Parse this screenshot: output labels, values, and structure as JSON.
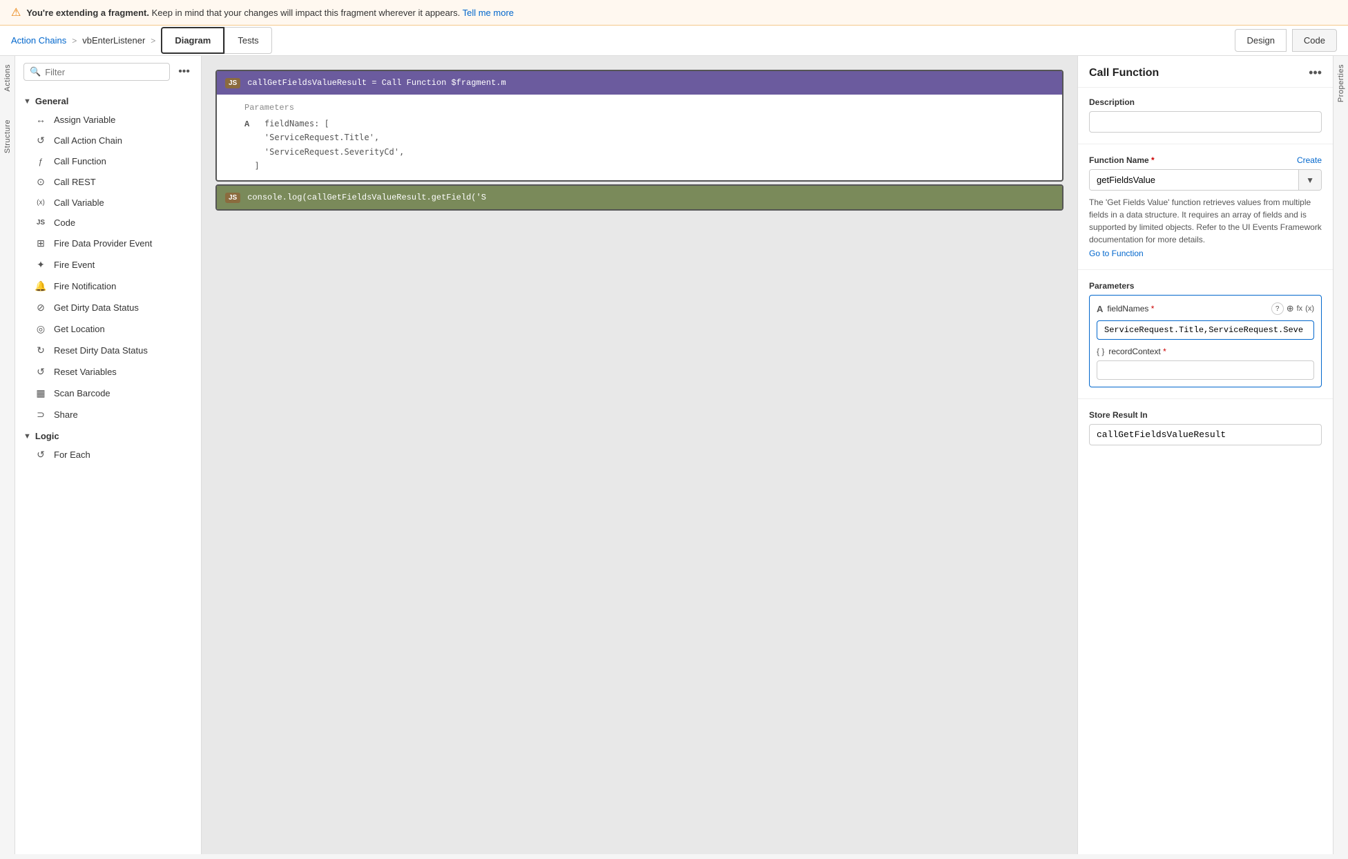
{
  "banner": {
    "icon": "⚠",
    "text_bold": "You're extending a fragment.",
    "text_normal": "Keep in mind that your changes will impact this fragment wherever it appears.",
    "link_text": "Tell me more"
  },
  "header": {
    "breadcrumb_link": "Action Chains",
    "breadcrumb_sep": ">",
    "breadcrumb_current": "vbEnterListener",
    "breadcrumb_sep2": ">",
    "tab_diagram": "Diagram",
    "tab_tests": "Tests",
    "btn_design": "Design",
    "btn_code": "Code"
  },
  "sidebar_labels": {
    "actions": "Actions",
    "structure": "Structure"
  },
  "left_panel": {
    "search_placeholder": "Filter",
    "more_icon": "•••",
    "general_section": "General",
    "logic_section": "Logic",
    "items_general": [
      {
        "id": "assign-variable",
        "label": "Assign Variable",
        "icon": "↔"
      },
      {
        "id": "call-action-chain",
        "label": "Call Action Chain",
        "icon": "↺"
      },
      {
        "id": "call-function",
        "label": "Call Function",
        "icon": "ƒ"
      },
      {
        "id": "call-rest",
        "label": "Call REST",
        "icon": "⊙"
      },
      {
        "id": "call-variable",
        "label": "Call Variable",
        "icon": "(x)"
      },
      {
        "id": "code",
        "label": "Code",
        "icon": "JS"
      },
      {
        "id": "fire-data-provider",
        "label": "Fire Data Provider Event",
        "icon": "⊞"
      },
      {
        "id": "fire-event",
        "label": "Fire Event",
        "icon": "✦"
      },
      {
        "id": "fire-notification",
        "label": "Fire Notification",
        "icon": "🔔"
      },
      {
        "id": "get-dirty-data",
        "label": "Get Dirty Data Status",
        "icon": "⊘"
      },
      {
        "id": "get-location",
        "label": "Get Location",
        "icon": "⊙"
      },
      {
        "id": "reset-dirty",
        "label": "Reset Dirty Data Status",
        "icon": "↻"
      },
      {
        "id": "reset-variables",
        "label": "Reset Variables",
        "icon": "↺"
      },
      {
        "id": "scan-barcode",
        "label": "Scan Barcode",
        "icon": "▦"
      },
      {
        "id": "share",
        "label": "Share",
        "icon": "⊃"
      }
    ],
    "items_logic": [
      {
        "id": "for-each",
        "label": "For Each",
        "icon": "↺"
      }
    ]
  },
  "canvas": {
    "block1": {
      "badge": "JS",
      "code_line": "callGetFieldsValueResult = Call Function $fragment.m",
      "params_label": "Parameters",
      "param_icon": "A",
      "param_value": "fieldNames: [\n  'ServiceRequest.Title',\n  'ServiceRequest.SeverityCd',\n]"
    },
    "block2": {
      "badge": "JS",
      "code_line": "console.log(callGetFieldsValueResult.getField('S"
    }
  },
  "right_panel": {
    "title": "Call Function",
    "more_icon": "•••",
    "desc_label": "Description",
    "desc_placeholder": "",
    "func_name_label": "Function Name",
    "required_star": "*",
    "create_link": "Create",
    "func_value": "getFieldsValue",
    "func_desc": "The 'Get Fields Value' function retrieves values from multiple fields in a data structure. It requires an array of fields and is supported by limited objects. Refer to the UI Events Framework documentation for more details.",
    "go_to_function": "Go to Function",
    "params_label": "Parameters",
    "param1_icon": "A",
    "param1_name": "fieldNames",
    "param1_required": "*",
    "param1_help": "?",
    "param1_globe": "⊕",
    "param1_fx": "fx",
    "param1_x": "(x)",
    "param1_value": "ServiceRequest.Title,ServiceRequest.Seve",
    "param2_icon": "{ }",
    "param2_name": "recordContext",
    "param2_required": "*",
    "param2_value": "",
    "store_label": "Store Result In",
    "store_value": "callGetFieldsValueResult"
  }
}
